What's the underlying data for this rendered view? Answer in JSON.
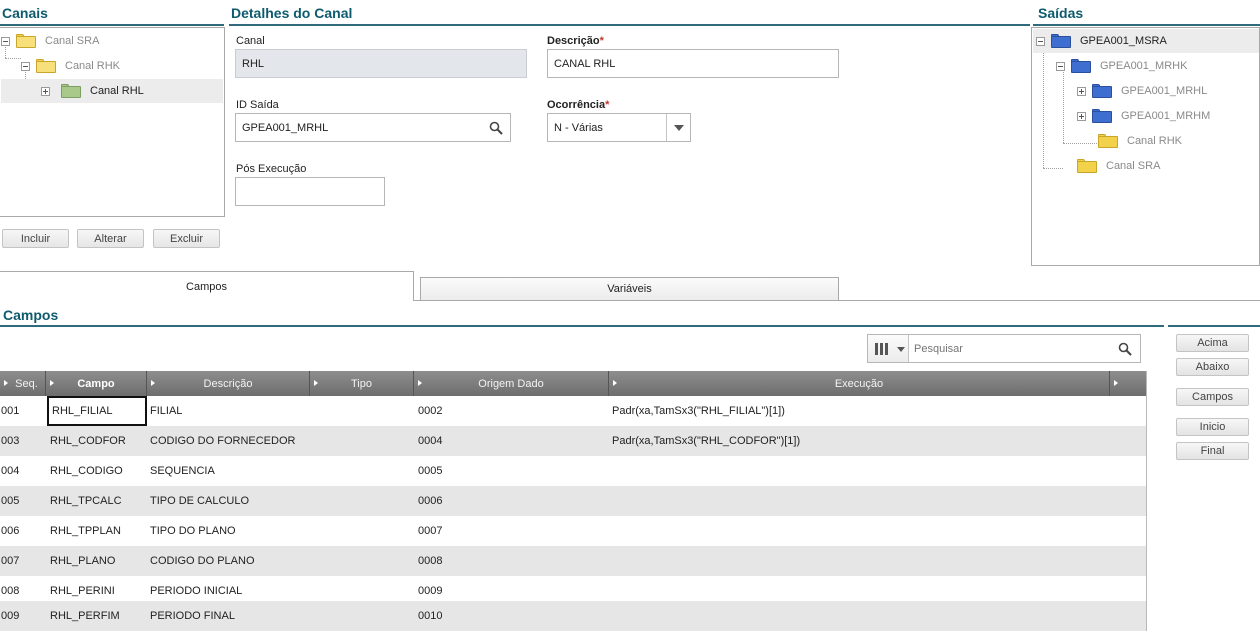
{
  "canais": {
    "title": "Canais",
    "tree": [
      {
        "label": "Canal SRA"
      },
      {
        "label": "Canal RHK"
      },
      {
        "label": "Canal RHL"
      }
    ],
    "buttons": {
      "incluir": "Incluir",
      "alterar": "Alterar",
      "excluir": "Excluir"
    }
  },
  "detalhes": {
    "title": "Detalhes do Canal",
    "canal_label": "Canal",
    "canal_value": "RHL",
    "descricao_label": "Descrição",
    "descricao_value": "CANAL RHL",
    "id_saida_label": "ID Saída",
    "id_saida_value": "GPEA001_MRHL",
    "ocorrencia_label": "Ocorrência",
    "ocorrencia_value": "N - Várias",
    "pos_execucao_label": "Pós Execução",
    "pos_execucao_value": "",
    "required_mark": "*"
  },
  "saidas": {
    "title": "Saídas",
    "tree": [
      {
        "label": "GPEA001_MSRA"
      },
      {
        "label": "GPEA001_MRHK"
      },
      {
        "label": "GPEA001_MRHL"
      },
      {
        "label": "GPEA001_MRHM"
      },
      {
        "label": "Canal RHK"
      },
      {
        "label": "Canal SRA"
      }
    ]
  },
  "tabs": [
    {
      "label": "Campos",
      "active": true
    },
    {
      "label": "Variáveis",
      "active": false
    }
  ],
  "campos": {
    "title": "Campos",
    "search_placeholder": "Pesquisar",
    "columns": [
      "Seq.",
      "Campo",
      "Descrição",
      "Tipo",
      "Origem Dado",
      "Execução"
    ],
    "rows": [
      {
        "seq": "001",
        "campo": "RHL_FILIAL",
        "descricao": "FILIAL",
        "tipo": "",
        "origem": "0002",
        "execucao": "Padr(xa,TamSx3(\"RHL_FILIAL\")[1])"
      },
      {
        "seq": "003",
        "campo": "RHL_CODFOR",
        "descricao": "CODIGO DO FORNECEDOR",
        "tipo": "",
        "origem": "0004",
        "execucao": "Padr(xa,TamSx3(\"RHL_CODFOR\")[1])"
      },
      {
        "seq": "004",
        "campo": "RHL_CODIGO",
        "descricao": "SEQUENCIA",
        "tipo": "",
        "origem": "0005",
        "execucao": ""
      },
      {
        "seq": "005",
        "campo": "RHL_TPCALC",
        "descricao": "TIPO DE CALCULO",
        "tipo": "",
        "origem": "0006",
        "execucao": ""
      },
      {
        "seq": "006",
        "campo": "RHL_TPPLAN",
        "descricao": "TIPO DO PLANO",
        "tipo": "",
        "origem": "0007",
        "execucao": ""
      },
      {
        "seq": "007",
        "campo": "RHL_PLANO",
        "descricao": "CODIGO DO PLANO",
        "tipo": "",
        "origem": "0008",
        "execucao": ""
      },
      {
        "seq": "008",
        "campo": "RHL_PERINI",
        "descricao": "PERIODO INICIAL",
        "tipo": "",
        "origem": "0009",
        "execucao": ""
      },
      {
        "seq": "009",
        "campo": "RHL_PERFIM",
        "descricao": "PERIODO FINAL",
        "tipo": "",
        "origem": "0010",
        "execucao": ""
      }
    ],
    "side_buttons": {
      "acima": "Acima",
      "abaixo": "Abaixo",
      "campos": "Campos",
      "inicio": "Inicio",
      "final": "Final"
    }
  },
  "icons": {
    "search": "search-icon",
    "columns": "columns-icon",
    "dropdown": "chevron-down-icon",
    "folder": "folder-icon",
    "expand": "expand-icon"
  },
  "colors": {
    "title": "#0e5a6e",
    "header": "#7a7a7a",
    "alt_row": "#e6e6e6",
    "folder_blue": "#3e6fd0",
    "folder_yellow": "#f2d24b",
    "folder_green": "#a9c98a"
  }
}
